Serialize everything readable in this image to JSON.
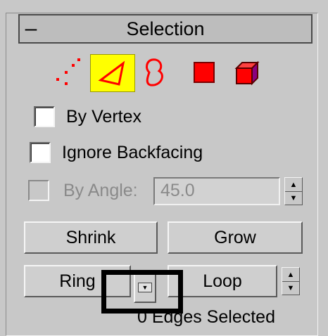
{
  "rollout": {
    "title": "Selection",
    "toggle": "–"
  },
  "subobject_icons": [
    {
      "name": "vertex-icon",
      "selected": false
    },
    {
      "name": "edge-icon",
      "selected": true
    },
    {
      "name": "border-icon",
      "selected": false
    },
    {
      "name": "polygon-icon",
      "selected": false
    },
    {
      "name": "element-icon",
      "selected": false
    }
  ],
  "checkboxes": {
    "by_vertex": {
      "label": "By Vertex",
      "checked": false,
      "enabled": true
    },
    "ignore_backfacing": {
      "label": "Ignore Backfacing",
      "checked": false,
      "enabled": true
    },
    "by_angle": {
      "label": "By Angle:",
      "checked": false,
      "enabled": false
    }
  },
  "angle_field": {
    "value": "45.0"
  },
  "buttons": {
    "shrink": "Shrink",
    "grow": "Grow",
    "ring": "Ring",
    "loop": "Loop"
  },
  "status": {
    "text": "0 Edges Selected"
  },
  "colors": {
    "selected_bg": "#ffff00",
    "icon_red": "#ff0000",
    "panel_bg": "#c8c8c8"
  }
}
